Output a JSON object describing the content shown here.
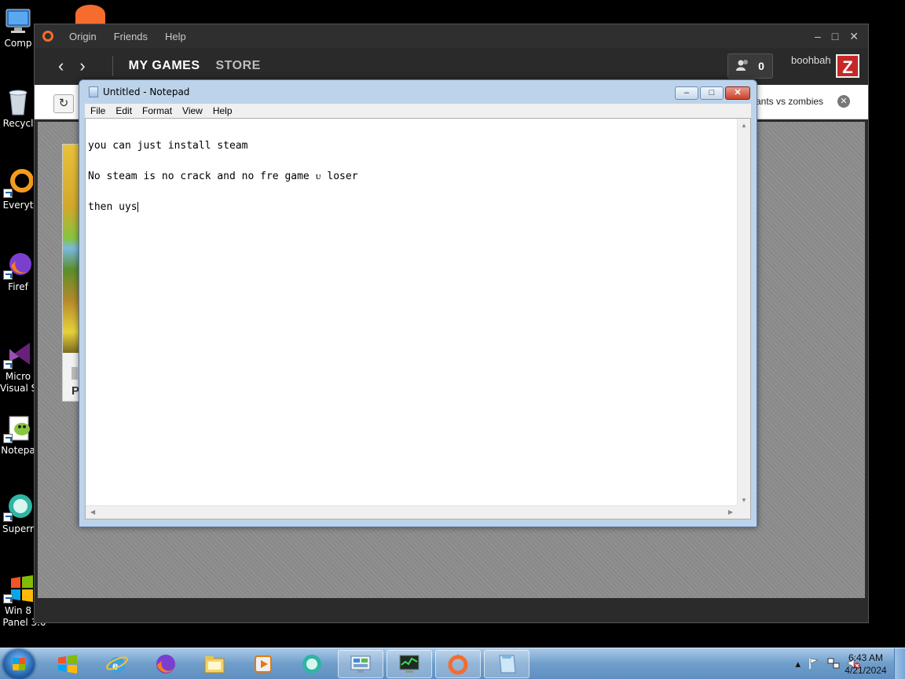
{
  "desktop": {
    "icons": [
      {
        "label": "Comp",
        "icon": "computer-icon"
      },
      {
        "label": "Recycl",
        "icon": "recycle-bin-icon"
      },
      {
        "label": "Everyt",
        "icon": "everything-search-icon"
      },
      {
        "label": "Firef",
        "icon": "firefox-icon"
      },
      {
        "label": "Micro",
        "label2": "Visual S",
        "icon": "visual-studio-icon"
      },
      {
        "label": "Notepa",
        "icon": "notepad-plus-plus-icon"
      },
      {
        "label": "Superr",
        "icon": "superrecorder-icon"
      },
      {
        "label": "Win 8",
        "label2": "Panel 3.0",
        "icon": "windows-flag-icon"
      }
    ]
  },
  "origin": {
    "menu": [
      "Origin",
      "Friends",
      "Help"
    ],
    "window_controls": [
      "minimize",
      "maximize",
      "close"
    ],
    "nav": {
      "back": "‹",
      "forward": "›",
      "tab_games": "MY GAMES",
      "tab_store": "STORE"
    },
    "friends_count": "0",
    "username": "boohbah",
    "avatar_letter": "Z",
    "search_value": "ants vs zombies",
    "game_tile_title": "P"
  },
  "notepad": {
    "title": "Untitled - Notepad",
    "menu": [
      "File",
      "Edit",
      "Format",
      "View",
      "Help"
    ],
    "lines": [
      "you can just install steam",
      "No steam is no crack and no fre game ᴜ loser",
      "then uys"
    ]
  },
  "taskbar": {
    "pinned": [
      "windows-flag-icon",
      "internet-explorer-icon",
      "firefox-icon",
      "file-explorer-icon",
      "media-player-icon",
      "superrecorder-icon",
      "control-panel-icon",
      "task-manager-icon",
      "origin-icon",
      "notepad-icon"
    ],
    "active": [
      "control-panel-icon",
      "task-manager-icon",
      "origin-icon",
      "notepad-icon"
    ],
    "tray": {
      "expand": "▴"
    },
    "clock_time": "6:43 AM",
    "clock_date": "4/21/2024"
  },
  "colors": {
    "origin_orange": "#f56c2d",
    "taskbar_blue": "#6f9ecb",
    "notepad_frame": "#bcd3ea"
  }
}
